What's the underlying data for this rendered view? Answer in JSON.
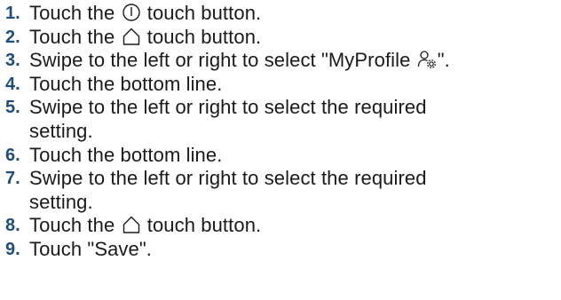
{
  "steps": [
    {
      "number": "1.",
      "before": "Touch the ",
      "icon": "power-icon",
      "after": " touch button."
    },
    {
      "number": "2.",
      "before": "Touch the ",
      "icon": "home-icon",
      "after": " touch button."
    },
    {
      "number": "3.",
      "before": "Swipe to the left or right to select \"MyProfile ",
      "icon": "myprofile-settings-icon",
      "after": "\"."
    },
    {
      "number": "4.",
      "text": "Touch the bottom line."
    },
    {
      "number": "5.",
      "text_line1": "Swipe to the left or right to select the required",
      "text_line2": "setting."
    },
    {
      "number": "6.",
      "text": "Touch the bottom line."
    },
    {
      "number": "7.",
      "text_line1": "Swipe to the left or right to select the required",
      "text_line2": "setting."
    },
    {
      "number": "8.",
      "before": "Touch the ",
      "icon": "home-icon",
      "after": " touch button."
    },
    {
      "number": "9.",
      "text": "Touch \"Save\"."
    }
  ]
}
